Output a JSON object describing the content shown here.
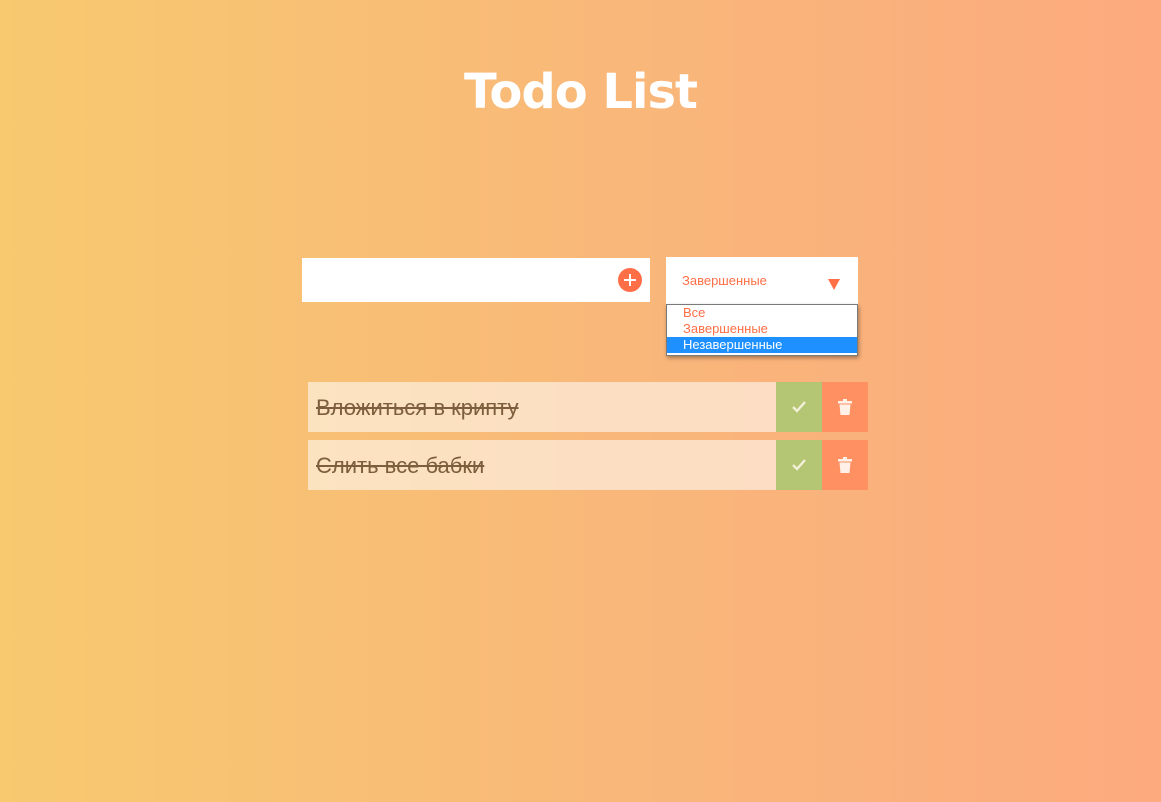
{
  "header": {
    "title": "Todo List"
  },
  "form": {
    "input_value": "",
    "add_icon": "plus-circle-icon"
  },
  "filter": {
    "selected_value": "Завершенные",
    "arrow_icon": "triangle-down-icon",
    "options": [
      {
        "label": "Все",
        "highlighted": false
      },
      {
        "label": "Завершенные",
        "highlighted": false
      },
      {
        "label": "Незавершенные",
        "highlighted": true
      }
    ]
  },
  "todos": [
    {
      "text": "Вложиться в крипту",
      "completed": true,
      "check_icon": "check-icon",
      "trash_icon": "trash-icon"
    },
    {
      "text": "Слить все бабки",
      "completed": true,
      "check_icon": "check-icon",
      "trash_icon": "trash-icon"
    }
  ],
  "colors": {
    "accent": "#ff6f47",
    "complete_button": "#b4c573",
    "trash_button": "#ff9062",
    "highlight": "#1e90ff",
    "background_start": "#f8c96f",
    "background_end": "#fcaa7e"
  }
}
